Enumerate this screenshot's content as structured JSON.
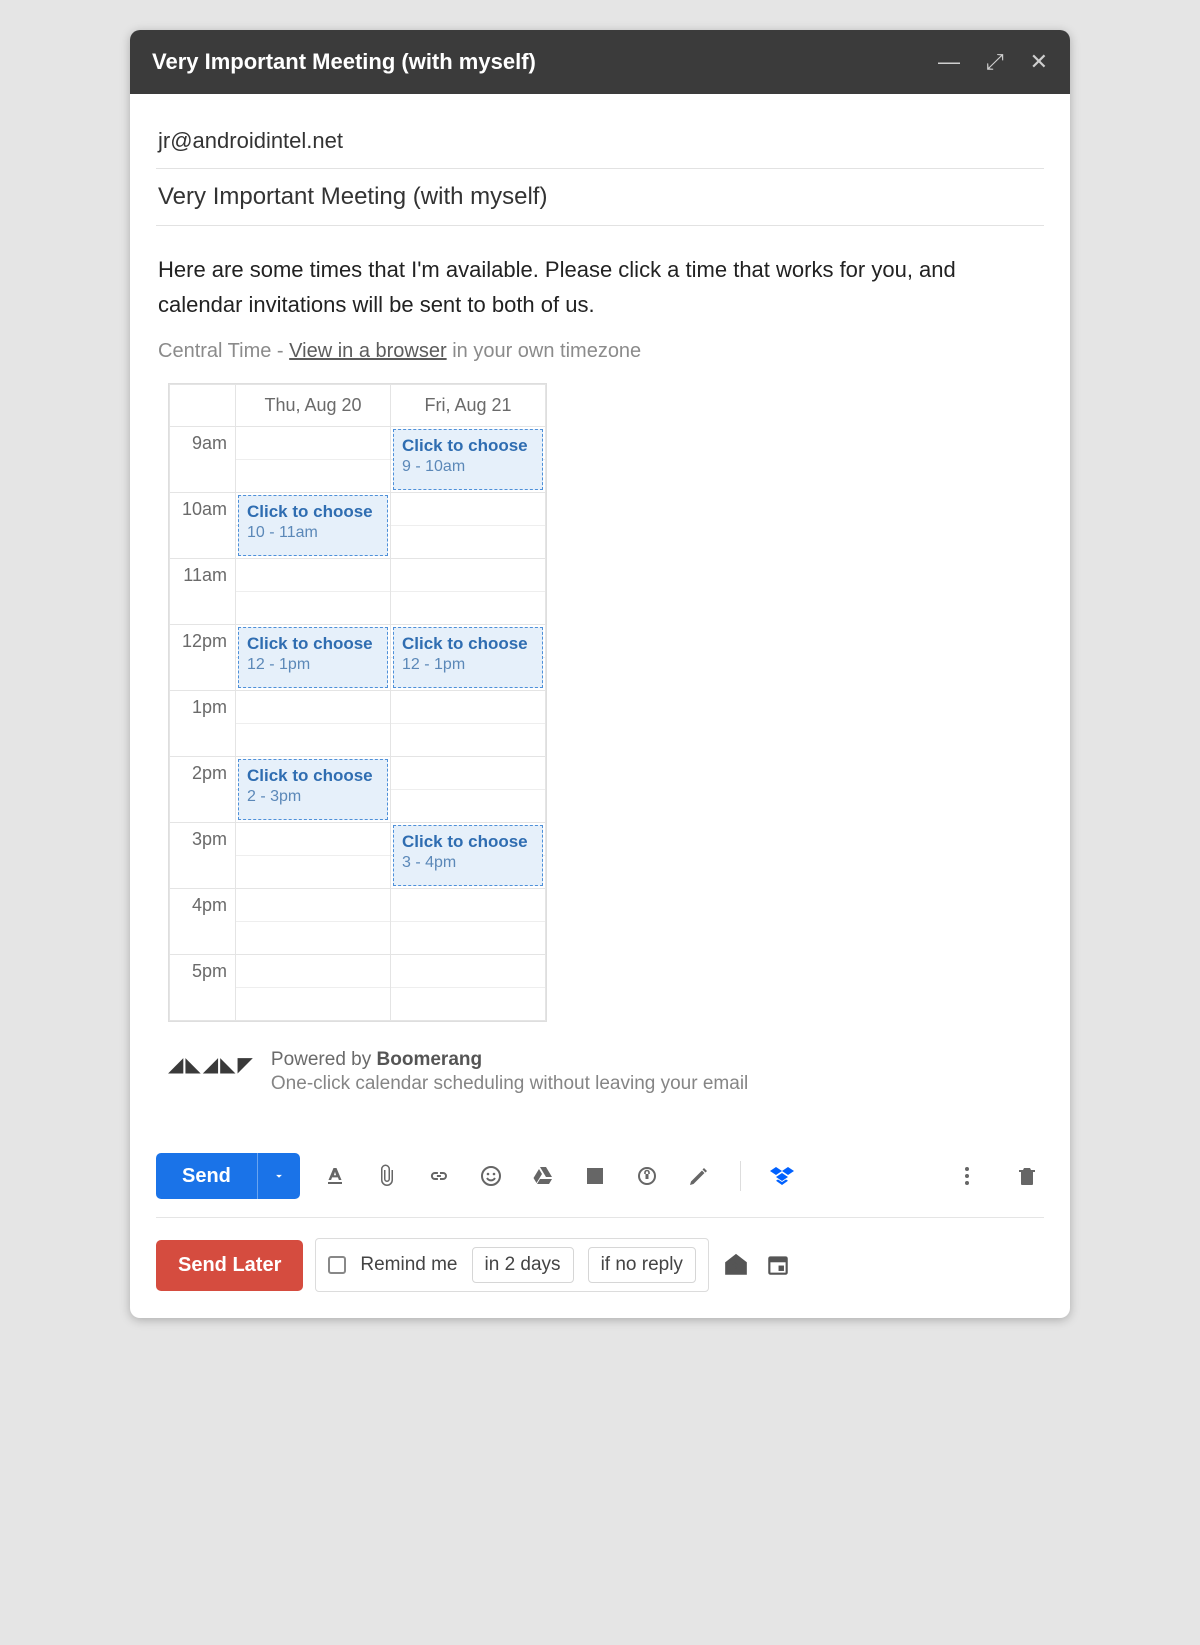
{
  "titlebar": {
    "title": "Very Important Meeting (with myself)"
  },
  "compose": {
    "to": "jr@androidintel.net",
    "subject": "Very Important Meeting (with myself)",
    "body": "Here are some times that I'm available. Please click a time that works for you, and calendar invitations will be sent to both of us.",
    "tz_prefix": "Central Time - ",
    "tz_link": "View in a browser",
    "tz_suffix": " in your own timezone"
  },
  "calendar": {
    "days": [
      "Thu, Aug 20",
      "Fri, Aug 21"
    ],
    "hours": [
      "9am",
      "10am",
      "11am",
      "12pm",
      "1pm",
      "2pm",
      "3pm",
      "4pm",
      "5pm"
    ],
    "slot_label": "Click to choose",
    "slots": [
      {
        "day": 1,
        "hour": 0,
        "range": "9 - 10am"
      },
      {
        "day": 0,
        "hour": 1,
        "range": "10 - 11am"
      },
      {
        "day": 0,
        "hour": 3,
        "range": "12 - 1pm"
      },
      {
        "day": 1,
        "hour": 3,
        "range": "12 - 1pm"
      },
      {
        "day": 0,
        "hour": 5,
        "range": "2 - 3pm"
      },
      {
        "day": 1,
        "hour": 6,
        "range": "3 - 4pm"
      }
    ]
  },
  "powered": {
    "line1_prefix": "Powered by ",
    "brand": "Boomerang",
    "line2": "One-click calendar scheduling without leaving your email"
  },
  "toolbar": {
    "send": "Send"
  },
  "bottom": {
    "send_later": "Send Later",
    "remind": "Remind me",
    "when": "in 2 days",
    "condition": "if no reply"
  }
}
